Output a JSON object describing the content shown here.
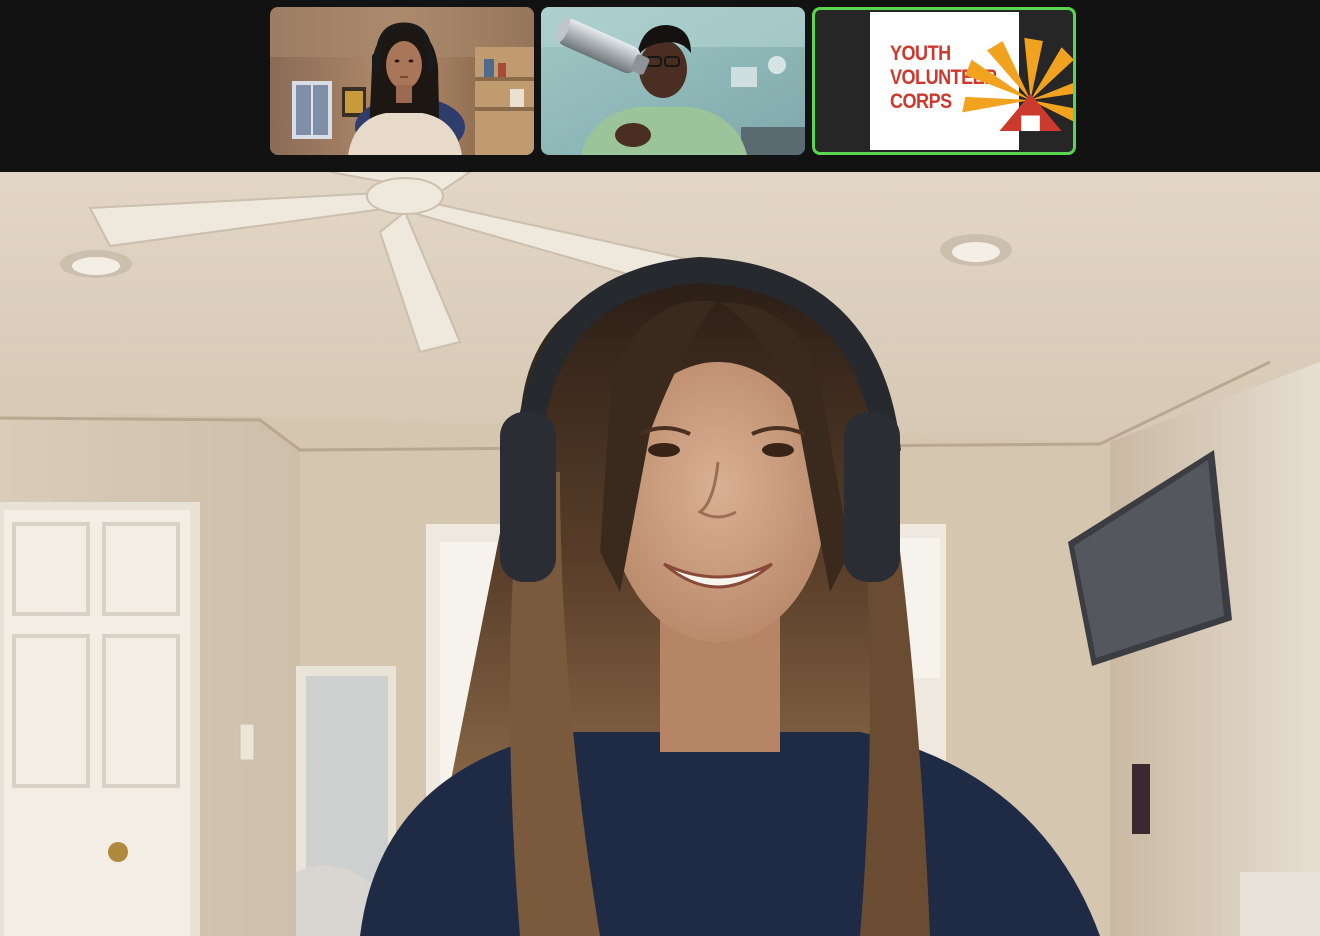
{
  "meeting": {
    "participants": [
      {
        "kind": "camera",
        "tile": "thumbnail-1"
      },
      {
        "kind": "camera",
        "tile": "thumbnail-2"
      },
      {
        "kind": "logo",
        "tile": "thumbnail-3",
        "active_speaker": true
      }
    ],
    "logo": {
      "line1": "YOUTH",
      "line2": "VOLUNTEER",
      "line3": "CORPS"
    }
  },
  "colors": {
    "active_speaker_border": "#5ad54f",
    "logo_text": "#cc3a2e",
    "logo_burst": "#f1a21f",
    "strip_background": "#121212"
  },
  "icons": [
    "burst-logo-icon"
  ]
}
